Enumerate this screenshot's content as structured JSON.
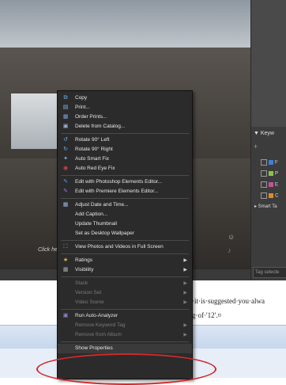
{
  "photo": {
    "hint_text": "Click he"
  },
  "right_panel": {
    "keywords_title": "▼ Keyw",
    "toolbar_add": "+",
    "rows": [
      "F",
      "P",
      "E",
      "C"
    ],
    "smart_tags": "▸ Smart Ta",
    "tag_select_placeholder": "Tag selecte"
  },
  "document": {
    "line1": "·it·is·suggested·you·alwa",
    "line2": "g·of·'12'.¤"
  },
  "menu": {
    "items": [
      {
        "label": "Copy",
        "icon": "copy-icon",
        "enabled": true,
        "submenu": false
      },
      {
        "label": "Print...",
        "icon": "print-icon",
        "enabled": true,
        "submenu": false
      },
      {
        "label": "Order Prints...",
        "icon": "order-prints-icon",
        "enabled": true,
        "submenu": false
      },
      {
        "label": "Delete from Catalog...",
        "icon": "delete-icon",
        "enabled": true,
        "submenu": false
      },
      {
        "label": "Rotate 90° Left",
        "icon": "rotate-left-icon",
        "enabled": true,
        "submenu": false
      },
      {
        "label": "Rotate 90° Right",
        "icon": "rotate-right-icon",
        "enabled": true,
        "submenu": false
      },
      {
        "label": "Auto Smart Fix",
        "icon": "smart-fix-icon",
        "enabled": true,
        "submenu": false
      },
      {
        "label": "Auto Red Eye Fix",
        "icon": "red-eye-icon",
        "enabled": true,
        "submenu": false
      },
      {
        "label": "Edit with Photoshop Elements Editor...",
        "icon": "photoshop-icon",
        "enabled": true,
        "submenu": false
      },
      {
        "label": "Edit with Premiere Elements Editor...",
        "icon": "premiere-icon",
        "enabled": true,
        "submenu": false
      },
      {
        "label": "Adjust Date and Time...",
        "icon": "calendar-icon",
        "enabled": true,
        "submenu": false
      },
      {
        "label": "Add Caption...",
        "icon": "",
        "enabled": true,
        "submenu": false
      },
      {
        "label": "Update Thumbnail",
        "icon": "",
        "enabled": true,
        "submenu": false
      },
      {
        "label": "Set as Desktop Wallpaper",
        "icon": "",
        "enabled": true,
        "submenu": false
      },
      {
        "label": "View Photos and Videos in Full Screen",
        "icon": "fullscreen-icon",
        "enabled": true,
        "submenu": false
      },
      {
        "label": "Ratings",
        "icon": "star-icon",
        "enabled": true,
        "submenu": true
      },
      {
        "label": "Visibility",
        "icon": "visibility-icon",
        "enabled": true,
        "submenu": true
      },
      {
        "label": "Stack",
        "icon": "",
        "enabled": false,
        "submenu": true
      },
      {
        "label": "Version Set",
        "icon": "",
        "enabled": false,
        "submenu": true
      },
      {
        "label": "Video Scene",
        "icon": "",
        "enabled": false,
        "submenu": true
      },
      {
        "label": "Run Auto-Analyzer",
        "icon": "analyzer-icon",
        "enabled": true,
        "submenu": false
      },
      {
        "label": "Remove Keyword Tag",
        "icon": "",
        "enabled": false,
        "submenu": true
      },
      {
        "label": "Remove from Album",
        "icon": "",
        "enabled": false,
        "submenu": true
      },
      {
        "label": "Show Properties",
        "icon": "",
        "enabled": true,
        "submenu": false
      }
    ]
  },
  "colors": {
    "menu_bg": "#2b2b2b",
    "highlight_ellipse": "#d0282a",
    "add_green": "#5fc65f"
  }
}
